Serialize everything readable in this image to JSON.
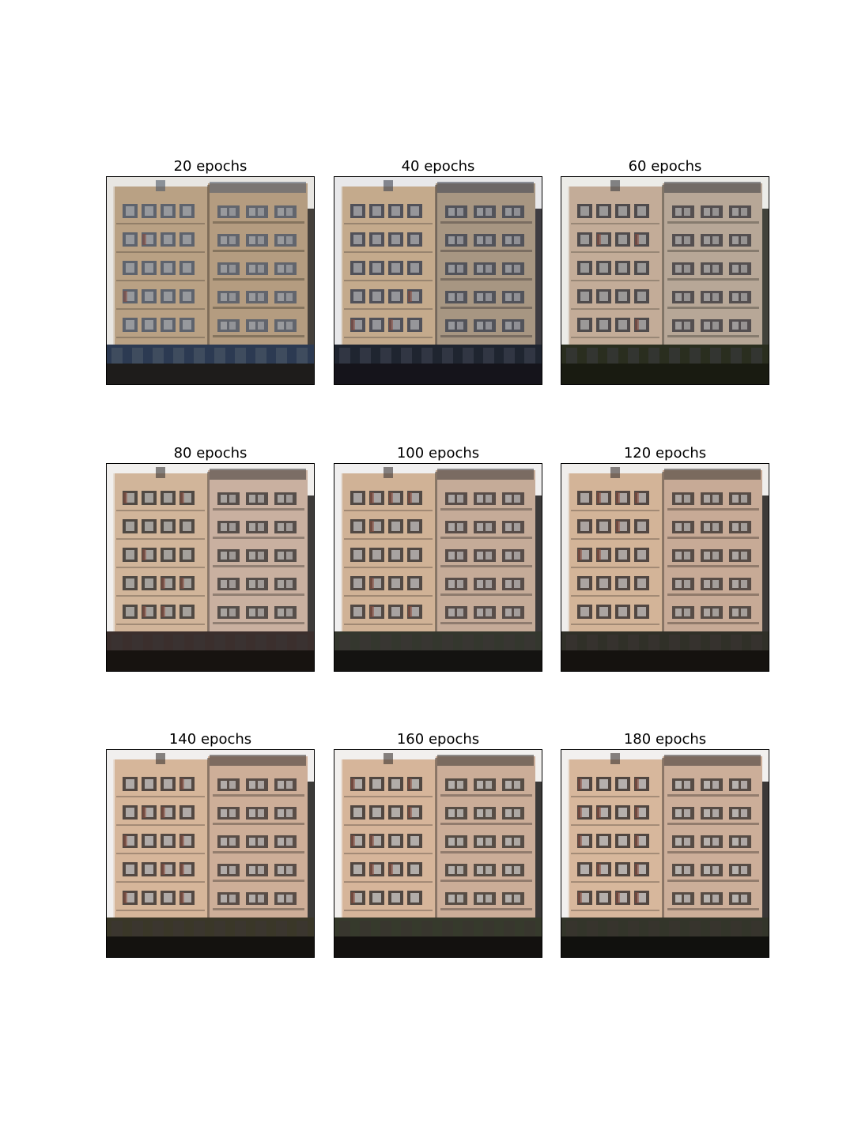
{
  "grid": {
    "panels": [
      {
        "title": "20 epochs",
        "style": {
          "sky": "#e8e6e2",
          "wall": "#b9a184",
          "wall2": "#b49c80",
          "window": "#4d5868",
          "shade": "#1c1712",
          "ground": "#2c3a52",
          "detail": 0.2
        }
      },
      {
        "title": "40 epochs",
        "style": {
          "sky": "#e8e8ea",
          "wall": "#c4aa8c",
          "wall2": "#a79682",
          "window": "#3d4250",
          "shade": "#141218",
          "ground": "#1f2530",
          "detail": 0.35
        }
      },
      {
        "title": "60 epochs",
        "style": {
          "sky": "#ecece8",
          "wall": "#c3ac98",
          "wall2": "#b7a797",
          "window": "#3b3a3e",
          "shade": "#16180f",
          "ground": "#2a2e1f",
          "detail": 0.45
        }
      },
      {
        "title": "80 epochs",
        "style": {
          "sky": "#f1efed",
          "wall": "#d1b59a",
          "wall2": "#c9b0a0",
          "window": "#3a3634",
          "shade": "#120e0c",
          "ground": "#3b2f2d",
          "detail": 0.6
        }
      },
      {
        "title": "100 epochs",
        "style": {
          "sky": "#f0efef",
          "wall": "#d0b296",
          "wall2": "#c5ab98",
          "window": "#3c3636",
          "shade": "#0f0d0c",
          "ground": "#34372e",
          "detail": 0.65
        }
      },
      {
        "title": "120 epochs",
        "style": {
          "sky": "#f0eeec",
          "wall": "#d3b498",
          "wall2": "#c7aa96",
          "window": "#3b3432",
          "shade": "#100d0b",
          "ground": "#303028",
          "detail": 0.7
        }
      },
      {
        "title": "140 epochs",
        "style": {
          "sky": "#f1efee",
          "wall": "#d6b69a",
          "wall2": "#cdae98",
          "window": "#3c3533",
          "shade": "#0e0c0a",
          "ground": "#3a3728",
          "detail": 0.8
        }
      },
      {
        "title": "160 epochs",
        "style": {
          "sky": "#f2f0ee",
          "wall": "#d6b59a",
          "wall2": "#cbad98",
          "window": "#3a3431",
          "shade": "#0d0b0a",
          "ground": "#363a2c",
          "detail": 0.85
        }
      },
      {
        "title": "180 epochs",
        "style": {
          "sky": "#f2f0ef",
          "wall": "#d7b79c",
          "wall2": "#ccae99",
          "window": "#3a3330",
          "shade": "#0c0a09",
          "ground": "#33352a",
          "detail": 0.9
        }
      }
    ]
  }
}
